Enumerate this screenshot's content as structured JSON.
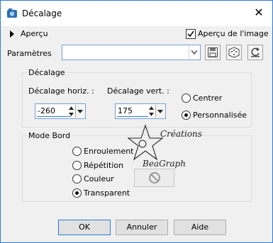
{
  "window": {
    "title": "Décalage"
  },
  "top": {
    "apercu_label": "Aperçu",
    "apercu_image_label": "Aperçu de l'image",
    "apercu_image_checked": true
  },
  "params": {
    "label": "Paramètres",
    "combo_value": ""
  },
  "decalage": {
    "legend": "Décalage",
    "horiz_label": "Décalage horiz. :",
    "horiz_value": "-260",
    "vert_label": "Décalage vert. :",
    "vert_value": "175",
    "options": [
      {
        "label": "Centrer",
        "selected": false
      },
      {
        "label": "Personnalisée",
        "selected": true
      }
    ]
  },
  "mode_bord": {
    "legend": "Mode Bord",
    "options": [
      {
        "label": "Enroulement",
        "selected": false
      },
      {
        "label": "Répétition",
        "selected": false
      },
      {
        "label": "Couleur",
        "selected": false
      },
      {
        "label": "Transparent",
        "selected": true
      }
    ]
  },
  "watermark": {
    "line1": "Créations",
    "line2": "BeaGraph"
  },
  "buttons": {
    "ok": "OK",
    "cancel": "Annuler",
    "help": "Aide"
  },
  "colors": {
    "accent": "#2d7bd6",
    "background": "#f0f0f0"
  }
}
